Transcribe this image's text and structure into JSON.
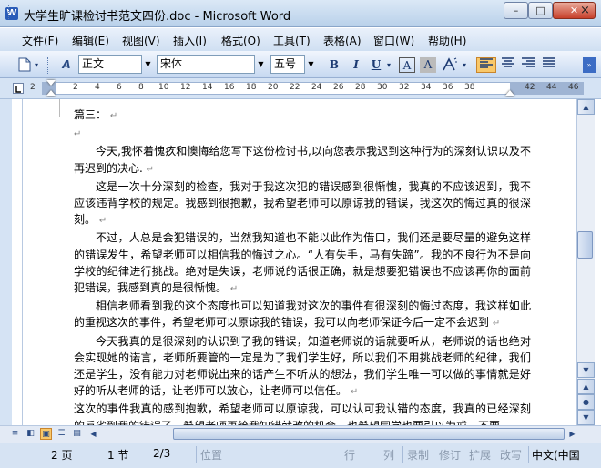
{
  "window": {
    "title": "大学生旷课检讨书范文四份.doc - Microsoft Word",
    "app_icon": "W",
    "min": "–",
    "max": "□",
    "close": "✕"
  },
  "menu": {
    "items": [
      "文件(F)",
      "编辑(E)",
      "视图(V)",
      "插入(I)",
      "格式(O)",
      "工具(T)",
      "表格(A)",
      "窗口(W)",
      "帮助(H)"
    ],
    "close": "×"
  },
  "toolbar": {
    "style": "正文",
    "font": "宋体",
    "size": "五号",
    "bold": "B",
    "italic": "I",
    "underline": "U",
    "char_border": "A",
    "char_shading": "A",
    "highlight": "A",
    "style_icon": "A"
  },
  "ruler": {
    "numbers": [
      "2",
      "2",
      "4",
      "6",
      "8",
      "10",
      "12",
      "14",
      "16",
      "18",
      "20",
      "22",
      "24",
      "26",
      "28",
      "30",
      "32",
      "34",
      "36",
      "38",
      "42",
      "44",
      "46"
    ]
  },
  "document": {
    "heading": "篇三：",
    "paragraphs": [
      "今天,我怀着愧疚和懊悔给您写下这份检讨书,以向您表示我迟到这种行为的深刻认识以及不再迟到的决心.",
      "这是一次十分深刻的检查，我对于我这次犯的错误感到很惭愧，我真的不应该迟到，我不应该违背学校的规定。我感到很抱歉，我希望老师可以原谅我的错误，我这次的悔过真的很深刻。",
      "不过，人总是会犯错误的，当然我知道也不能以此作为借口，我们还是要尽量的避免这样的错误发生，希望老师可以相信我的悔过之心。“人有失手，马有失蹄”。我的不良行为不是向学校的纪律进行挑战。绝对是失误，老师说的话很正确，就是想要犯错误也不应该再你的面前犯错误，我感到真的是很惭愧。",
      "相信老师看到我的这个态度也可以知道我对这次的事件有很深刻的悔过态度，我这样如此的重视这次的事件，希望老师可以原谅我的错误，我可以向老师保证今后一定不会迟到",
      "今天我真的是很深刻的认识到了我的错误，知道老师说的话就要听从，老师说的话也绝对会实现她的诺言，老师所要管的一定是为了我们学生好，所以我们不用挑战老师的纪律，我们还是学生，没有能力对老师说出来的话产生不听从的想法，我们学生唯一可以做的事情就是好好的听从老师的话，让老师可以放心，让老师可以信任。",
      "这次的事件我真的感到抱歉，希望老师可以原谅我，可以认可我认错的态度，我真的已经深刻的反省到我的错误了，希望老师再给我知错就改的机会。也希望同学也要引以为戒，不要"
    ],
    "paragraph_mark": "↵"
  },
  "status": {
    "page": "2 页",
    "section": "1 节",
    "pages": "2/3",
    "position": "位置",
    "line": "行",
    "column": "列",
    "rec": "录制",
    "trk": "修订",
    "ext": "扩展",
    "ovr": "改写",
    "language": "中文(中国"
  }
}
